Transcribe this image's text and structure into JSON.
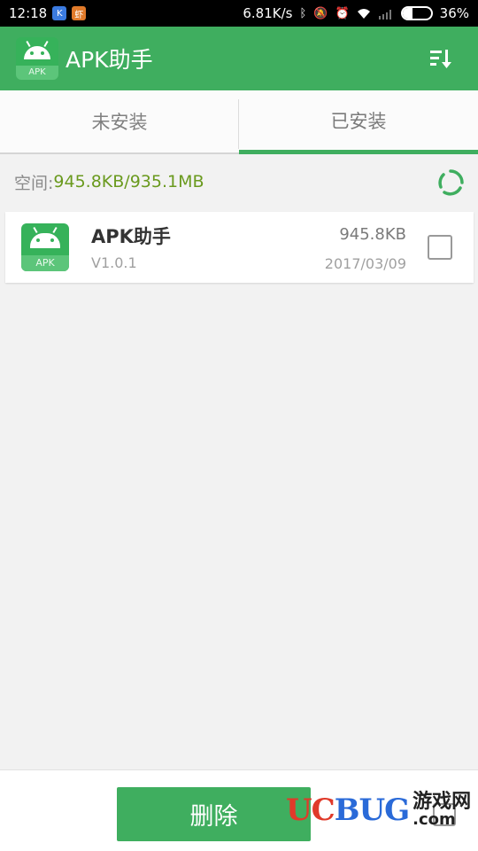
{
  "status_bar": {
    "time": "12:18",
    "net_speed": "6.81K/s",
    "battery": "36%",
    "battery_level": 0.36,
    "notif_icon_1": "k-app-icon",
    "notif_icon_2": "虾",
    "icons": [
      "bluetooth-icon",
      "mute-icon",
      "alarm-icon",
      "wifi-icon",
      "signal-icon",
      "battery-icon"
    ]
  },
  "app_bar": {
    "title": "APK助手",
    "icon_text": "APK",
    "color": "#3fae5f"
  },
  "tabs": [
    {
      "label": "未安装",
      "active": false
    },
    {
      "label": "已安装",
      "active": true
    }
  ],
  "space": {
    "label": "空间:",
    "value": "945.8KB/935.1MB"
  },
  "list": [
    {
      "name": "APK助手",
      "icon_text": "APK",
      "version": "V1.0.1",
      "size": "945.8KB",
      "date": "2017/03/09",
      "checked": false
    }
  ],
  "bottom": {
    "delete_label": "删除",
    "watermark": {
      "u": "U",
      "c": "C",
      "rest": "BUG",
      "cn": "游戏网",
      "domain": ".com"
    }
  }
}
